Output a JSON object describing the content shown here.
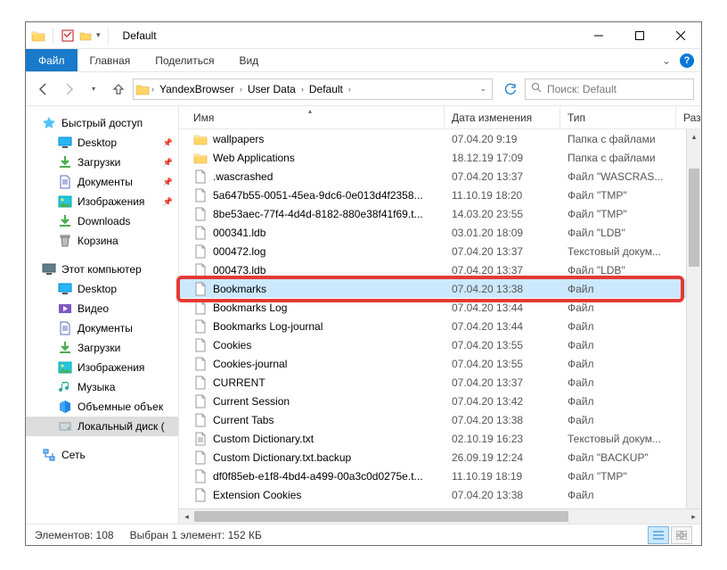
{
  "window": {
    "title": "Default"
  },
  "tabs": {
    "file": "Файл",
    "home": "Главная",
    "share": "Поделиться",
    "view": "Вид"
  },
  "breadcrumbs": [
    "YandexBrowser",
    "User Data",
    "Default"
  ],
  "search": {
    "placeholder": "Поиск: Default"
  },
  "columns": {
    "name": "Имя",
    "date": "Дата изменения",
    "type": "Тип",
    "size": "Раз"
  },
  "nav": {
    "quick": "Быстрый доступ",
    "quick_items": [
      "Desktop",
      "Загрузки",
      "Документы",
      "Изображения",
      "Downloads",
      "Корзина"
    ],
    "this_pc": "Этот компьютер",
    "pc_items": [
      "Desktop",
      "Видео",
      "Документы",
      "Загрузки",
      "Изображения",
      "Музыка",
      "Объемные объек",
      "Локальный диск ("
    ],
    "network": "Сеть"
  },
  "rows": [
    {
      "ico": "folder",
      "name": "wallpapers",
      "date": "07.04.20 9:19",
      "type": "Папка с файлами"
    },
    {
      "ico": "folder",
      "name": "Web Applications",
      "date": "18.12.19 17:09",
      "type": "Папка с файлами"
    },
    {
      "ico": "file",
      "name": ".wascrashed",
      "date": "07.04.20 13:37",
      "type": "Файл \"WASCRAS..."
    },
    {
      "ico": "file",
      "name": "5a647b55-0051-45ea-9dc6-0e013d4f2358...",
      "date": "11.10.19 18:20",
      "type": "Файл \"TMP\""
    },
    {
      "ico": "file",
      "name": "8be53aec-77f4-4d4d-8182-880e38f41f69.t...",
      "date": "14.03.20 23:55",
      "type": "Файл \"TMP\""
    },
    {
      "ico": "file",
      "name": "000341.ldb",
      "date": "03.01.20 18:09",
      "type": "Файл \"LDB\""
    },
    {
      "ico": "file",
      "name": "000472.log",
      "date": "07.04.20 13:37",
      "type": "Текстовый докум..."
    },
    {
      "ico": "file",
      "name": "000473.ldb",
      "date": "07.04.20 13:37",
      "type": "Файл \"LDB\""
    },
    {
      "ico": "file",
      "name": "Bookmarks",
      "date": "07.04.20 13:38",
      "type": "Файл",
      "sel": true
    },
    {
      "ico": "file",
      "name": "Bookmarks Log",
      "date": "07.04.20 13:44",
      "type": "Файл"
    },
    {
      "ico": "file",
      "name": "Bookmarks Log-journal",
      "date": "07.04.20 13:44",
      "type": "Файл"
    },
    {
      "ico": "file",
      "name": "Cookies",
      "date": "07.04.20 13:55",
      "type": "Файл"
    },
    {
      "ico": "file",
      "name": "Cookies-journal",
      "date": "07.04.20 13:55",
      "type": "Файл"
    },
    {
      "ico": "file",
      "name": "CURRENT",
      "date": "07.04.20 13:37",
      "type": "Файл"
    },
    {
      "ico": "file",
      "name": "Current Session",
      "date": "07.04.20 13:42",
      "type": "Файл"
    },
    {
      "ico": "file",
      "name": "Current Tabs",
      "date": "07.04.20 13:38",
      "type": "Файл"
    },
    {
      "ico": "txt",
      "name": "Custom Dictionary.txt",
      "date": "02.10.19 16:23",
      "type": "Текстовый докум..."
    },
    {
      "ico": "file",
      "name": "Custom Dictionary.txt.backup",
      "date": "26.09.19 12:24",
      "type": "Файл \"BACKUP\""
    },
    {
      "ico": "file",
      "name": "df0f85eb-e1f8-4bd4-a499-00a3c0d0275e.t...",
      "date": "11.10.19 18:19",
      "type": "Файл \"TMP\""
    },
    {
      "ico": "file",
      "name": "Extension Cookies",
      "date": "07.04.20 13:38",
      "type": "Файл"
    }
  ],
  "status": {
    "items": "Элементов: 108",
    "selected": "Выбран 1 элемент: 152 КБ"
  }
}
